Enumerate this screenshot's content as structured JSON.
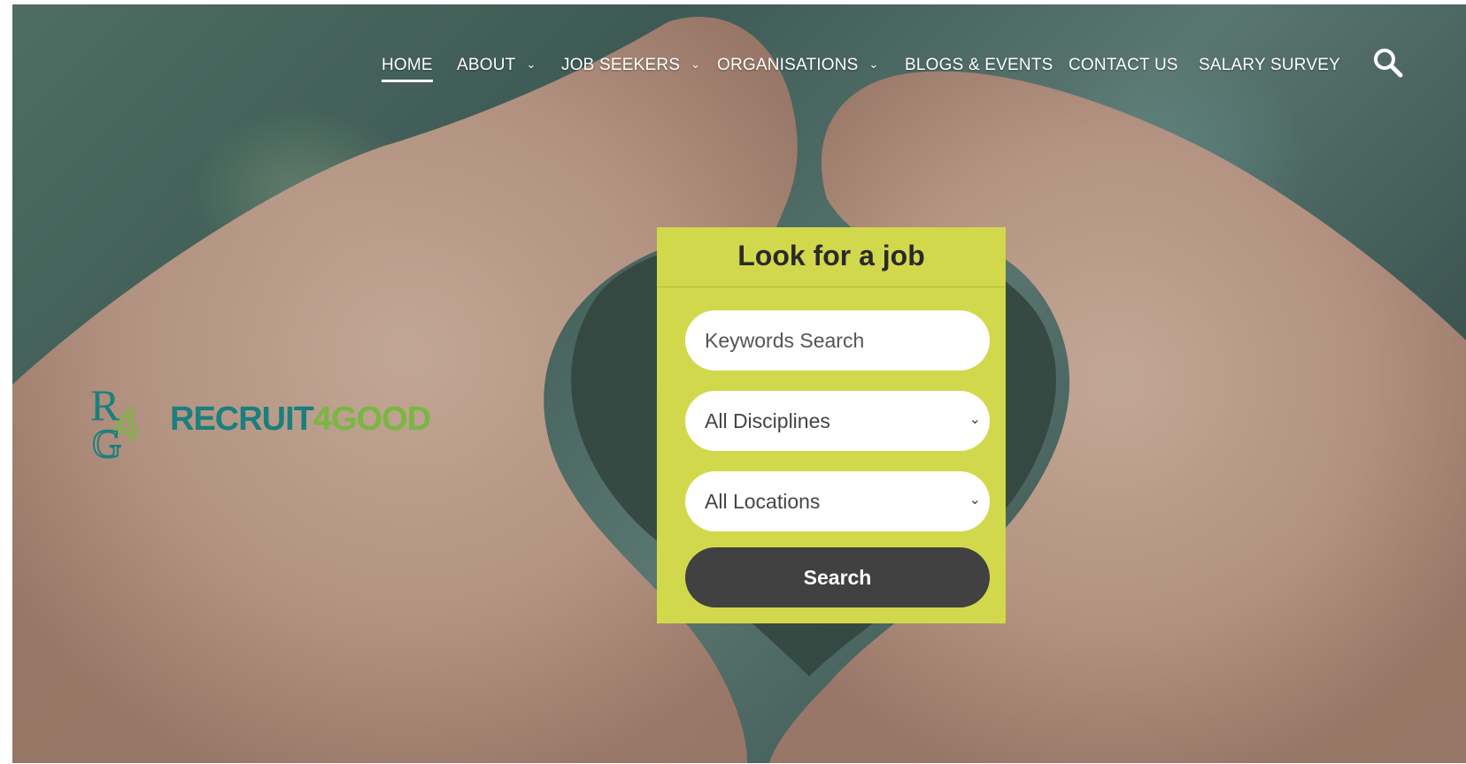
{
  "nav": {
    "items": [
      {
        "label": "HOME",
        "has_dropdown": false,
        "active": true
      },
      {
        "label": "ABOUT",
        "has_dropdown": true,
        "active": false
      },
      {
        "label": "JOB SEEKERS",
        "has_dropdown": true,
        "active": false
      },
      {
        "label": "ORGANISATIONS",
        "has_dropdown": true,
        "active": false
      },
      {
        "label": "BLOGS & EVENTS",
        "has_dropdown": false,
        "active": false
      },
      {
        "label": "CONTACT US",
        "has_dropdown": false,
        "active": false
      },
      {
        "label": "SALARY SURVEY",
        "has_dropdown": false,
        "active": false
      }
    ],
    "search_icon": "magnifier-icon"
  },
  "logo": {
    "text_part1": "RECRUIT",
    "text_part2": "4GOOD",
    "color_primary": "#1b7f7e",
    "color_secondary": "#78b742"
  },
  "job_search": {
    "title": "Look for a job",
    "keywords_placeholder": "Keywords Search",
    "disciplines_selected": "All Disciplines",
    "locations_selected": "All Locations",
    "search_label": "Search",
    "card_color": "#d2d84b",
    "button_color": "#414141"
  }
}
